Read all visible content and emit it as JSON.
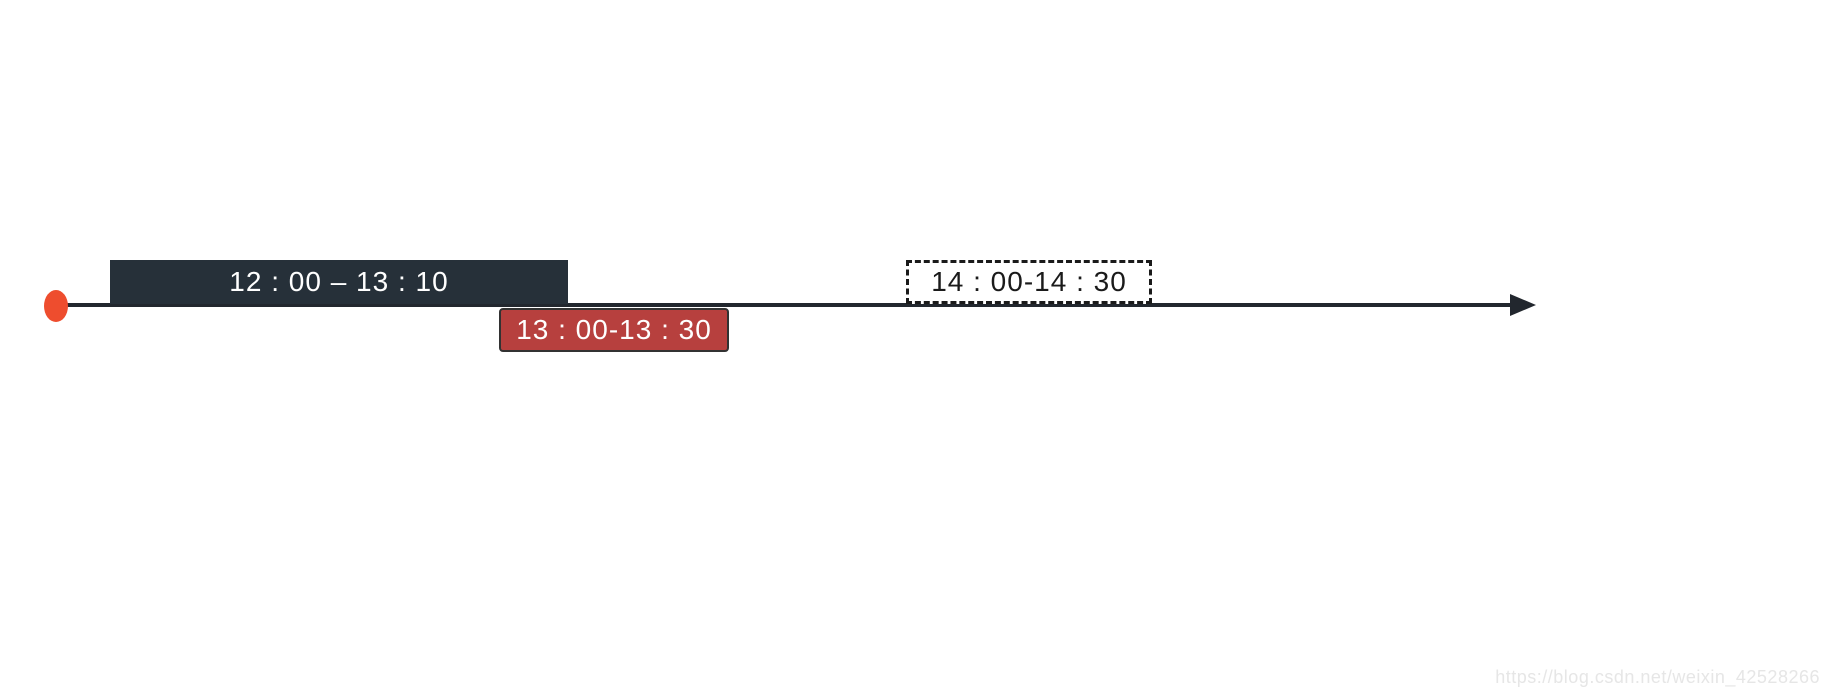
{
  "timeline": {
    "blocks": [
      {
        "label": "12 : 00 – 13 : 10",
        "style": "solid-dark",
        "position": "above"
      },
      {
        "label": "13 : 00-13 : 30",
        "style": "solid-red",
        "position": "below"
      },
      {
        "label": "14 : 00-14 : 30",
        "style": "dashed-open",
        "position": "above"
      }
    ],
    "start_marker": "origin",
    "axis_direction": "right"
  },
  "watermark": "https://blog.csdn.net/weixin_42528266"
}
